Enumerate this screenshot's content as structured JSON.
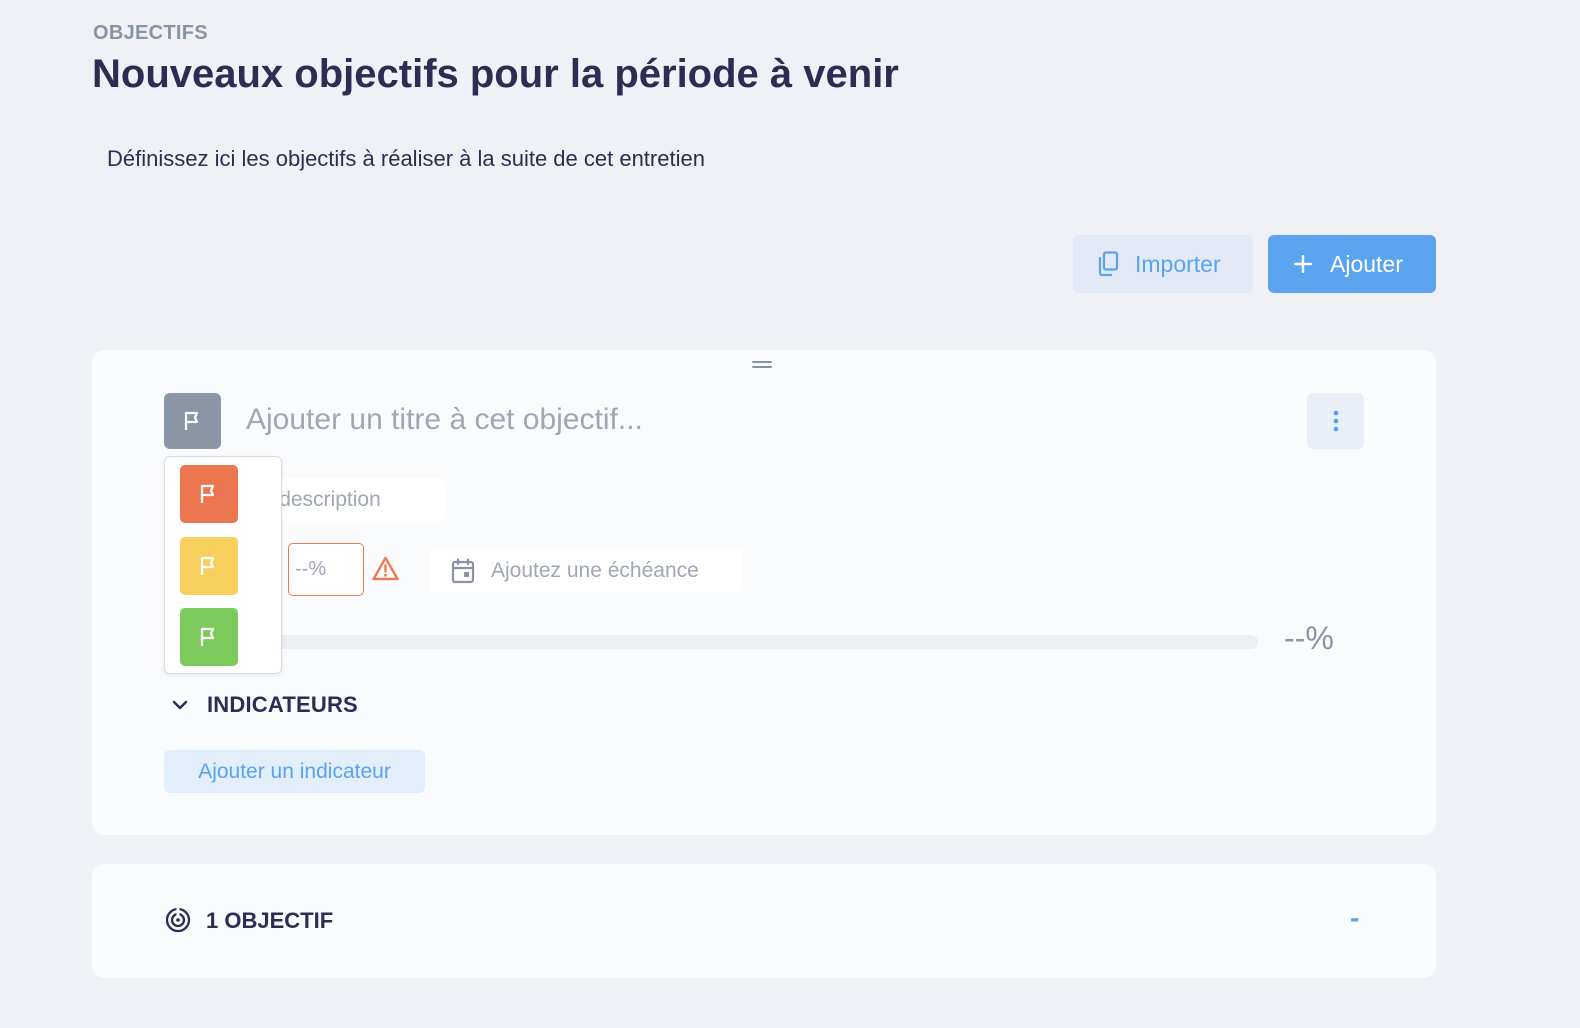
{
  "section": {
    "eyebrow": "OBJECTIFS",
    "title": "Nouveaux objectifs pour la période à venir",
    "intro": "Définissez ici les objectifs à réaliser à la suite de cet entretien"
  },
  "actions": {
    "import_label": "Importer",
    "add_label": "Ajouter"
  },
  "objective": {
    "title_placeholder": "Ajouter un titre à cet objectif...",
    "description_placeholder": "Ajoutez une description",
    "description_visible": "ne description",
    "percent_placeholder": "--%",
    "due_placeholder": "Ajoutez une échéance",
    "progress_display": "--%",
    "progress_fraction": 0,
    "indicators_title": "INDICATEURS",
    "add_indicator_label": "Ajouter un indicateur",
    "status_color": "#8a96a5"
  },
  "status_options": [
    {
      "name": "red",
      "color": "#ec764f"
    },
    {
      "name": "yellow",
      "color": "#f6cf5d"
    },
    {
      "name": "green",
      "color": "#7cca5c"
    }
  ],
  "summary": {
    "label": "1 OBJECTIF",
    "value": "-"
  },
  "colors": {
    "accent": "#5aa3ee",
    "warning": "#ee7a52",
    "text": "#2c2d52",
    "muted": "#8a93a6"
  },
  "icons": {
    "import": "copy-icon",
    "add": "plus-icon",
    "status": "flag-icon",
    "more": "vertical-dots-icon",
    "warning": "warning-triangle-icon",
    "due": "calendar-icon",
    "toggle": "chevron-down-icon",
    "summary": "target-icon"
  }
}
